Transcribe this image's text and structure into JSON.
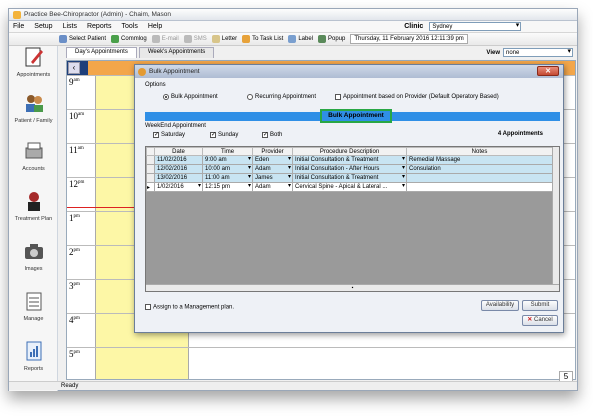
{
  "window": {
    "title": "Practice Bee-Chiropractor (Admin) - Chaim, Mason"
  },
  "menu": {
    "items": [
      "File",
      "Setup",
      "Lists",
      "Reports",
      "Tools",
      "Help"
    ],
    "clinic_label": "Clinic",
    "clinic_value": "Sydney"
  },
  "toolbar": {
    "select_patient": "Select Patient",
    "commlog": "Commlog",
    "email": "E-mail",
    "sms": "SMS",
    "letter": "Letter",
    "to_task_list": "To Task List",
    "label": "Label",
    "popup": "Popup",
    "datetime": "Thursday, 11 February 2016 12:11:39 pm"
  },
  "sidebar": {
    "items": [
      "Appointments",
      "Patient / Family",
      "Accounts",
      "Treatment Plan",
      "Images",
      "Manage",
      "Reports"
    ]
  },
  "tabs": [
    "Day's Appointments",
    "Week's Appointments"
  ],
  "view": {
    "label": "View",
    "value": "none"
  },
  "calendar": {
    "hours": [
      {
        "h": "9",
        "s": "am"
      },
      {
        "h": "10",
        "s": "am"
      },
      {
        "h": "11",
        "s": "am"
      },
      {
        "h": "12",
        "s": "pm"
      },
      {
        "h": "1",
        "s": "pm"
      },
      {
        "h": "2",
        "s": "pm"
      },
      {
        "h": "3",
        "s": "pm"
      },
      {
        "h": "4",
        "s": "pm"
      },
      {
        "h": "5",
        "s": "pm"
      }
    ],
    "right_marker": "5"
  },
  "status": {
    "text": "Ready"
  },
  "dialog": {
    "title": "Bulk Appointment",
    "options_label": "Options",
    "opt_bulk": "Bulk Appointment",
    "opt_recurring": "Recurring Appointment",
    "opt_provider": "Appointment based on Provider (Default Operatory Based)",
    "banner": "Bulk Appointment",
    "weekend_label": "WeekEnd Appointment",
    "saturday": "Saturday",
    "sunday": "Sunday",
    "both": "Both",
    "count": "4 Appointments",
    "columns": [
      "Date",
      "Time",
      "Provider",
      "Procedure Description",
      "Notes"
    ],
    "rows": [
      [
        "11/02/2016",
        "9:00 am",
        "Eden",
        "Initial Consultation & Treatment",
        "Remedial Massage"
      ],
      [
        "12/02/2016",
        "10:00 am",
        "Adam",
        "Initial Consultation - After Hours",
        "Consulation"
      ],
      [
        "13/02/2016",
        "11:00 am",
        "James",
        "Initial Consultation & Treatment",
        ""
      ],
      [
        "1/02/2016",
        "12:15 pm",
        "Adam",
        "Cervical Spine - Apical & Lateral ...",
        ""
      ]
    ],
    "assign_label": "Assign to a Management plan.",
    "availability_btn": "Availability",
    "submit_btn": "Submit",
    "cancel_btn": "Cancel"
  }
}
